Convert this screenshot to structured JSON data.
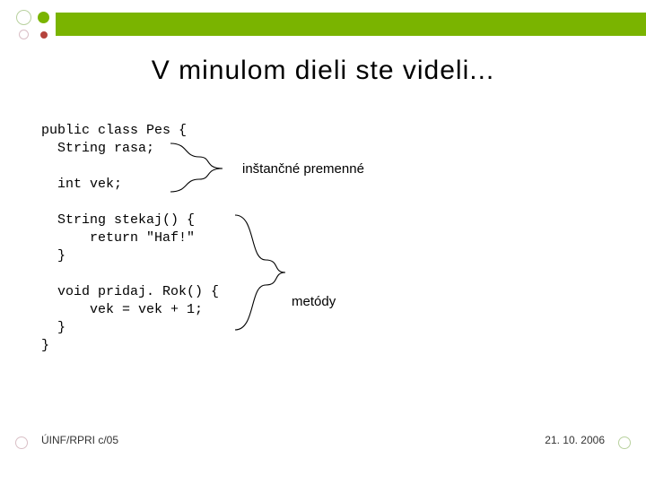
{
  "title": "V minulom dieli ste videli...",
  "code": {
    "l1": "public class Pes {",
    "l2": "  String rasa;",
    "l3": "",
    "l4": "  int vek;",
    "l5": "",
    "l6": "  String stekaj() {",
    "l7": "      return \"Haf!\"",
    "l8": "  }",
    "l9": "",
    "l10": "  void pridaj. Rok() {",
    "l11": "      vek = vek + 1;",
    "l12": "  }",
    "l13": "}"
  },
  "annotations": {
    "instance_vars": "inštančné premenné",
    "methods": "metódy"
  },
  "footer": {
    "left": "ÚINF/RPRI c/05",
    "right": "21. 10. 2006"
  }
}
